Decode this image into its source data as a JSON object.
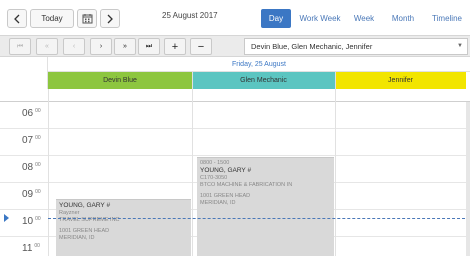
{
  "toolbar": {
    "prev_icon": "chevron-left-icon",
    "today_label": "Today",
    "calendar_icon": "calendar-icon",
    "next_icon": "chevron-right-icon",
    "current_date": "25 August 2017",
    "views": [
      {
        "label": "Day",
        "active": true
      },
      {
        "label": "Work Week",
        "active": false
      },
      {
        "label": "Week",
        "active": false
      },
      {
        "label": "Month",
        "active": false
      },
      {
        "label": "Timeline",
        "active": false
      }
    ]
  },
  "navigation": {
    "first_icon": "⏮",
    "prev_fast_icon": "«",
    "prev_icon": "‹",
    "next_icon": "›",
    "next_fast_icon": "»",
    "last_icon": "⏭",
    "add_label": "+",
    "remove_label": "−",
    "resource_select_value": "Devin Blue, Glen Mechanic, Jennifer"
  },
  "schedule": {
    "date_header": "Friday, 25 August",
    "resources": [
      {
        "name": "Devin Blue",
        "color": "#8dc63f"
      },
      {
        "name": "Glen Mechanic",
        "color": "#5bc5c1"
      },
      {
        "name": "Jennifer",
        "color": "#f2e500"
      }
    ],
    "hours": [
      {
        "hour": "06",
        "min": "00"
      },
      {
        "hour": "07",
        "min": "00"
      },
      {
        "hour": "08",
        "min": "00"
      },
      {
        "hour": "09",
        "min": "00"
      },
      {
        "hour": "10",
        "min": "00"
      },
      {
        "hour": "11",
        "min": "00"
      }
    ]
  },
  "appointments": {
    "glen": {
      "time": "0800 - 1500",
      "title": "YOUNG, GARY #",
      "line1": "C170-3050",
      "line2": "BTCO MACHINE & FABRICATION IN",
      "line3": "1001 GREEN HEAD",
      "line4": "MERIDIAN, ID"
    },
    "devin": {
      "title": "YOUNG, GARY #",
      "line1": "Rayzner",
      "line2": "TRAVEL SUPREME INC",
      "line3": "1001 GREEN HEAD",
      "line4": "MERIDIAN, ID"
    }
  }
}
